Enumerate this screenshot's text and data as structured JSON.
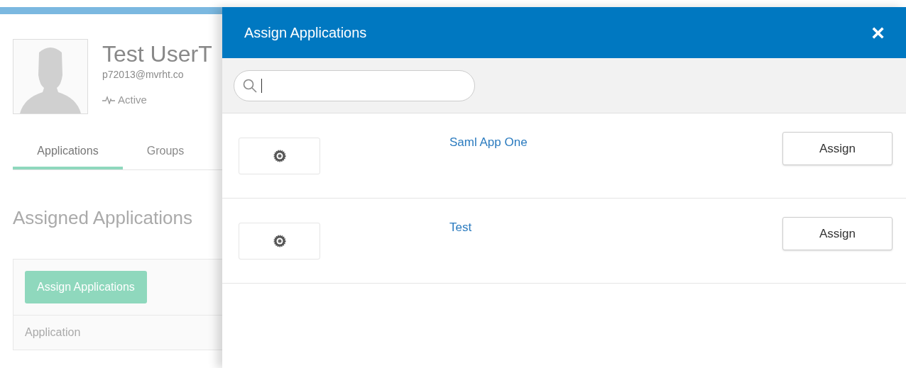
{
  "profile": {
    "name": "Test UserT",
    "email": "p72013@mvrht.co",
    "status": "Active"
  },
  "tabs": [
    {
      "label": "Applications",
      "selected": true
    },
    {
      "label": "Groups",
      "selected": false
    }
  ],
  "section_title": "Assigned Applications",
  "assign_button": "Assign Applications",
  "table": {
    "columns": [
      "Application"
    ]
  },
  "modal": {
    "title": "Assign Applications",
    "close": "×",
    "apps": [
      {
        "name": "Saml App One",
        "button": "Assign"
      },
      {
        "name": "Test",
        "button": "Assign"
      }
    ]
  }
}
